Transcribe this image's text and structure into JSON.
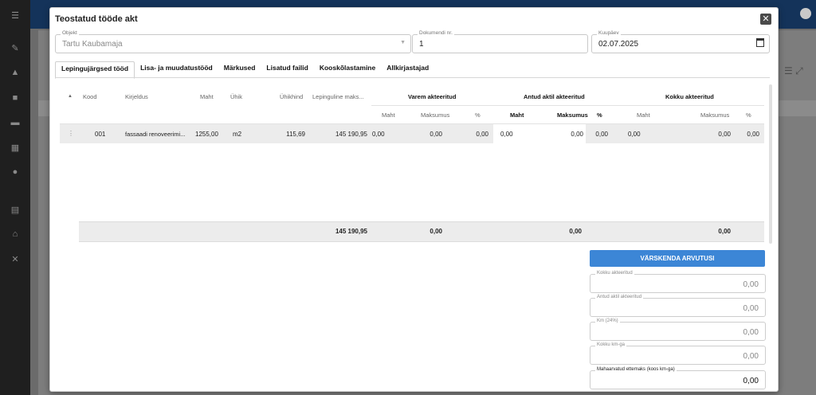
{
  "modal": {
    "title": "Teostatud tööde akt",
    "close_symbol": "✕",
    "objekt": {
      "label": "Objekt",
      "value": "Tartu Kaubamaja"
    },
    "dokument": {
      "label": "Dokumendi nr.",
      "value": "1"
    },
    "kuupaev": {
      "label": "Kuupäev",
      "value": "02.07.2025"
    }
  },
  "tabs": [
    {
      "label": "Lepingujärgsed tööd"
    },
    {
      "label": "Lisa- ja muudatustööd"
    },
    {
      "label": "Märkused"
    },
    {
      "label": "Lisatud failid"
    },
    {
      "label": "Kooskõlastamine"
    },
    {
      "label": "Allkirjastajad"
    }
  ],
  "table": {
    "headers": {
      "kood": "Kood",
      "kirjeldus": "Kirjeldus",
      "maht": "Maht",
      "uhik": "Ühik",
      "uhikhind": "Ühikhind",
      "lepinguline": "Lepinguline maks...",
      "varem": "Varem akteeritud",
      "antud": "Antud aktil akteeritud",
      "kokku": "Kokku akteeritud",
      "sub_maht": "Maht",
      "sub_maksumus": "Maksumus",
      "sub_pct": "%"
    },
    "row": {
      "kood": "001",
      "kirjeldus": "fassaadi renoveerimi...",
      "maht": "1255,00",
      "uhik": "m2",
      "uhikhind": "115,69",
      "lepinguline": "145 190,95",
      "varem_maht": "0,00",
      "varem_maksumus": "0,00",
      "varem_pct": "0,00",
      "antud_maht": "0,00",
      "antud_maksumus": "0,00",
      "antud_pct": "0,00",
      "kokku_maht": "0,00",
      "kokku_maksumus": "0,00",
      "kokku_pct": "0,00"
    },
    "totals": {
      "lepinguline": "145 190,95",
      "varem": "0,00",
      "antud": "0,00",
      "kokku": "0,00"
    }
  },
  "summary": {
    "button": "VÄRSKENDA ARVUTUSI",
    "fields": [
      {
        "label": "Kokku akteeritud",
        "value": "0,00"
      },
      {
        "label": "Antud aktil akteeritud",
        "value": "0,00"
      },
      {
        "label": "Km (24%)",
        "value": "0,00"
      },
      {
        "label": "Kokku km-ga",
        "value": "0,00"
      },
      {
        "label": "Mahaarvatud ettemaks (koos km-ga)",
        "value": "0,00"
      }
    ]
  }
}
